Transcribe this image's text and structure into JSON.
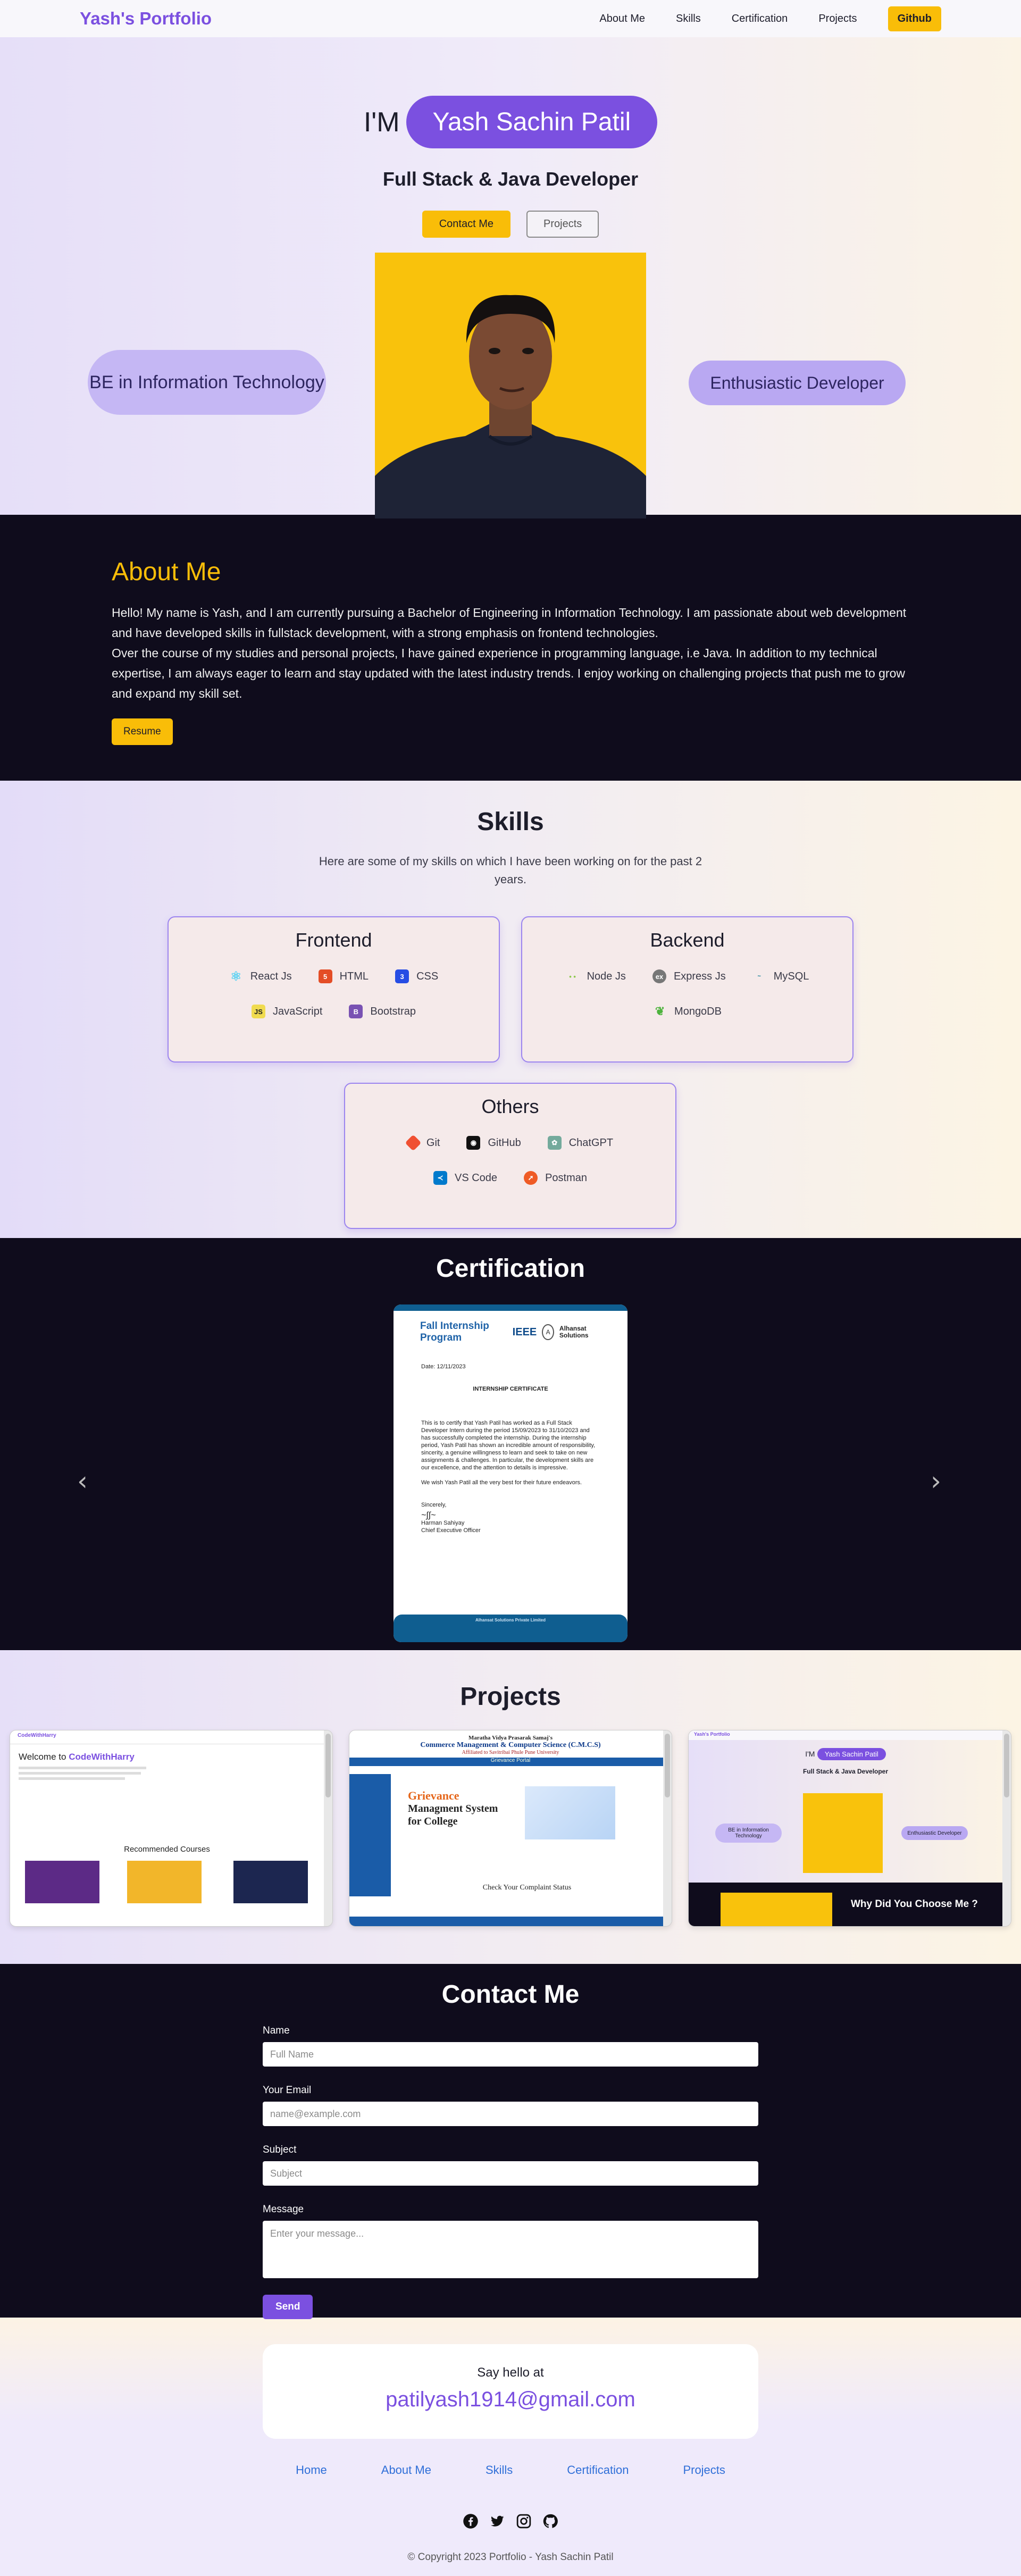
{
  "nav": {
    "brand": "Yash's Portfolio",
    "links": [
      "About Me",
      "Skills",
      "Certification",
      "Projects"
    ],
    "github": "Github"
  },
  "hero": {
    "prefix": "I'M",
    "name": "Yash Sachin Patil",
    "subtitle": "Full Stack & Java Developer",
    "contact_btn": "Contact Me",
    "projects_btn": "Projects",
    "left_pill": "BE in Information Technology",
    "right_pill": "Enthusiastic Developer"
  },
  "about": {
    "title": "About Me",
    "text": "Hello! My name is Yash, and I am currently pursuing a Bachelor of Engineering in Information Technology. I am passionate about web development and have developed skills in fullstack development, with a strong emphasis on frontend technologies.",
    "text2": "Over the course of my studies and personal projects, I have gained experience in programming language, i.e Java. In addition to my technical expertise, I am always eager to learn and stay updated with the latest industry trends. I enjoy working on challenging projects that push me to grow and expand my skill set.",
    "resume_btn": "Resume"
  },
  "skills": {
    "title": "Skills",
    "description": "Here are some of my skills on which I have been working on for the past 2 years.",
    "groups": [
      {
        "title": "Frontend",
        "items": [
          {
            "name": "React Js",
            "icon": "react-icon",
            "color": "#5ed3f3"
          },
          {
            "name": "HTML",
            "icon": "html-icon",
            "color": "#e44d26"
          },
          {
            "name": "CSS",
            "icon": "css-icon",
            "color": "#264de4"
          },
          {
            "name": "JavaScript",
            "icon": "javascript-icon",
            "color": "#f0db4f"
          },
          {
            "name": "Bootstrap",
            "icon": "bootstrap-icon",
            "color": "#7952b3"
          }
        ]
      },
      {
        "title": "Backend",
        "items": [
          {
            "name": "Node Js",
            "icon": "nodejs-icon",
            "color": "#8cc84b"
          },
          {
            "name": "Express Js",
            "icon": "express-icon",
            "color": "#777777"
          },
          {
            "name": "MySQL",
            "icon": "mysql-icon",
            "color": "#00758f"
          },
          {
            "name": "MongoDB",
            "icon": "mongodb-icon",
            "color": "#4db33d"
          }
        ]
      },
      {
        "title": "Others",
        "items": [
          {
            "name": "Git",
            "icon": "git-icon",
            "color": "#f05032"
          },
          {
            "name": "GitHub",
            "icon": "github-icon",
            "color": "#111111"
          },
          {
            "name": "ChatGPT",
            "icon": "chatgpt-icon",
            "color": "#74aa9c"
          },
          {
            "name": "VS Code",
            "icon": "vscode-icon",
            "color": "#007acc"
          },
          {
            "name": "Postman",
            "icon": "postman-icon",
            "color": "#ef5b25"
          }
        ]
      }
    ]
  },
  "certification": {
    "title": "Certification",
    "doc_title": "Fall Internship Program",
    "ieee": "IEEE",
    "partner": "Alhansat Solutions",
    "date": "Date: 12/11/2023",
    "heading": "INTERNSHIP CERTIFICATE",
    "body": "This is to certify that Yash Patil has worked as a Full Stack Developer Intern during the period 15/09/2023 to 31/10/2023 and has successfully completed the internship. During the internship period, Yash Patil has shown an incredible amount of responsibility, sincerity, a genuine willingness to learn and seek to take on new assignments & challenges. In particular, the development skills are our excellence, and the attention to details is impressive.",
    "wish": "We wish Yash Patil all the very best for their future endeavors.",
    "sincerely": "Sincerely,",
    "signer": "Harman Sahiyay",
    "signer_title": "Chief Executive Officer",
    "footer_company": "Alhansat Solutions Private Limited"
  },
  "projects": {
    "title": "Projects",
    "p1": {
      "brand": "CodeWithHarry",
      "welcome": "Welcome to",
      "welcome_brand": "CodeWithHarry",
      "section": "Recommended Courses"
    },
    "p2": {
      "college": "Maratha Vidya Prasarak Samaj's",
      "inst": "Commerce Management & Computer Science (C.M.C.S)",
      "uni": "Affiliated to Savitribai Phule Pune University",
      "bar": "Grievance Portal",
      "headline1": "Grievance",
      "headline2": "Managment System",
      "headline3": "for College",
      "status": "Check Your Complaint Status"
    },
    "p3": {
      "brand": "Yash's Portfolio",
      "prefix": "I'M",
      "name": "Yash Sachin Patil",
      "subtitle": "Full Stack & Java Developer",
      "left": "BE in Information Technology",
      "right": "Enthusiastic Developer",
      "bottom": "Why Did You Choose Me ?"
    }
  },
  "contact": {
    "title": "Contact Me",
    "name_label": "Name",
    "name_placeholder": "Full Name",
    "email_label": "Your Email",
    "email_placeholder": "name@example.com",
    "subject_label": "Subject",
    "subject_placeholder": "Subject",
    "message_label": "Message",
    "message_placeholder": "Enter your message...",
    "send": "Send"
  },
  "footer": {
    "say_hello": "Say hello at",
    "email": "patilyash1914@gmail.com",
    "links": [
      "Home",
      "About Me",
      "Skills",
      "Certification",
      "Projects"
    ],
    "socials": [
      "facebook-icon",
      "twitter-icon",
      "instagram-icon",
      "github-icon"
    ],
    "copyright": "© Copyright 2023 Portfolio - Yash Sachin Patil"
  },
  "colors": {
    "accent": "#7b50e0",
    "yellow": "#f9bd08",
    "dark": "#0f0c1c"
  }
}
